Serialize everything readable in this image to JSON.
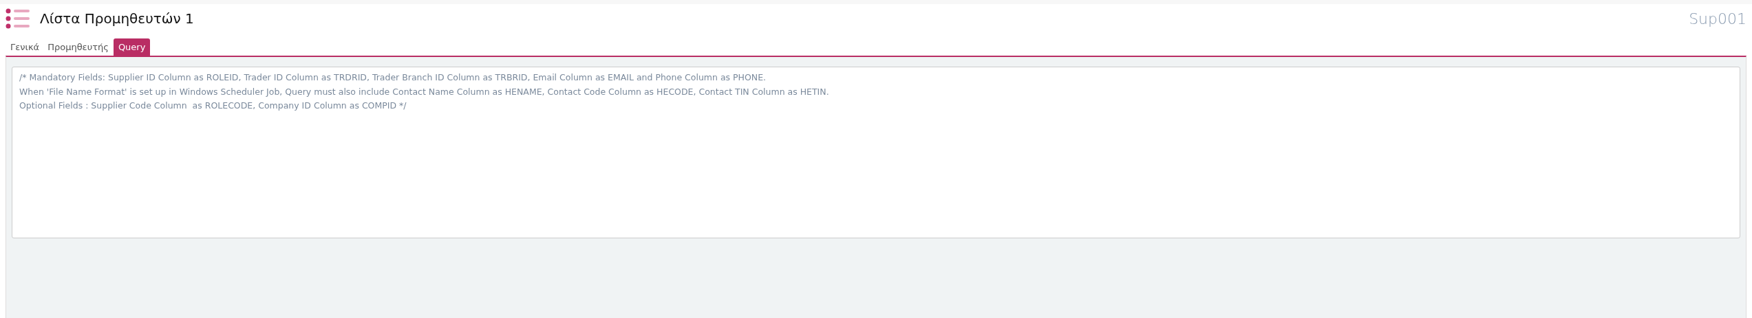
{
  "header": {
    "title": "Λίστα Προμηθευτών 1",
    "code": "Sup001"
  },
  "tabs": [
    {
      "label": "Γενικά",
      "selected": false
    },
    {
      "label": "Προμηθευτής",
      "selected": false
    },
    {
      "label": "Query",
      "selected": true
    }
  ],
  "query": {
    "value": "/* Mandatory Fields: Supplier ID Column as ROLEID, Trader ID Column as TRDRID, Trader Branch ID Column as TRBRID, Email Column as EMAIL and Phone Column as PHONE.\nWhen 'File Name Format' is set up in Windows Scheduler Job, Query must also include Contact Name Column as HENAME, Contact Code Column as HECODE, Contact TIN Column as HETIN.\nOptional Fields : Supplier Code Column  as ROLECODE, Company ID Column as COMPID */"
  }
}
